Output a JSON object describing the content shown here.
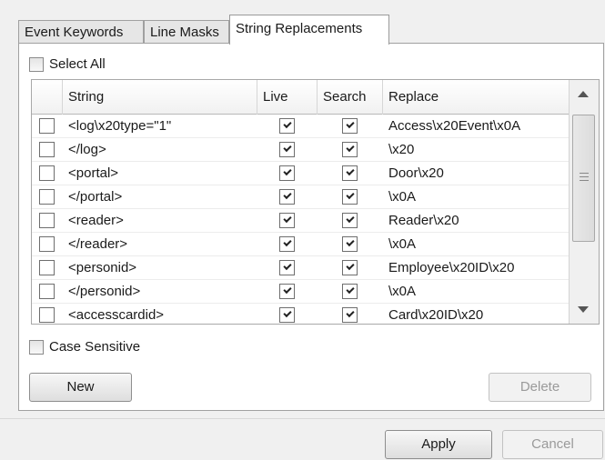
{
  "tabs": [
    {
      "label": "Event Keywords"
    },
    {
      "label": "Line Masks"
    },
    {
      "label": "String Replacements"
    }
  ],
  "select_all": {
    "label": "Select All",
    "checked": false
  },
  "grid": {
    "columns": {
      "string": "String",
      "live": "Live",
      "search": "Search",
      "replace": "Replace"
    },
    "rows": [
      {
        "string": "<log\\x20type=\"1\"",
        "live": true,
        "search": true,
        "replace": "Access\\x20Event\\x0A"
      },
      {
        "string": "</log>",
        "live": true,
        "search": true,
        "replace": "\\x20"
      },
      {
        "string": "<portal>",
        "live": true,
        "search": true,
        "replace": "Door\\x20"
      },
      {
        "string": "</portal>",
        "live": true,
        "search": true,
        "replace": "\\x0A"
      },
      {
        "string": "<reader>",
        "live": true,
        "search": true,
        "replace": "Reader\\x20"
      },
      {
        "string": "</reader>",
        "live": true,
        "search": true,
        "replace": "\\x0A"
      },
      {
        "string": "<personid>",
        "live": true,
        "search": true,
        "replace": "Employee\\x20ID\\x20"
      },
      {
        "string": "</personid>",
        "live": true,
        "search": true,
        "replace": "\\x0A"
      },
      {
        "string": "<accesscardid>",
        "live": true,
        "search": true,
        "replace": "Card\\x20ID\\x20"
      }
    ]
  },
  "case_sensitive": {
    "label": "Case Sensitive",
    "checked": false
  },
  "buttons": {
    "new": "New",
    "delete": "Delete",
    "apply": "Apply",
    "cancel": "Cancel"
  }
}
